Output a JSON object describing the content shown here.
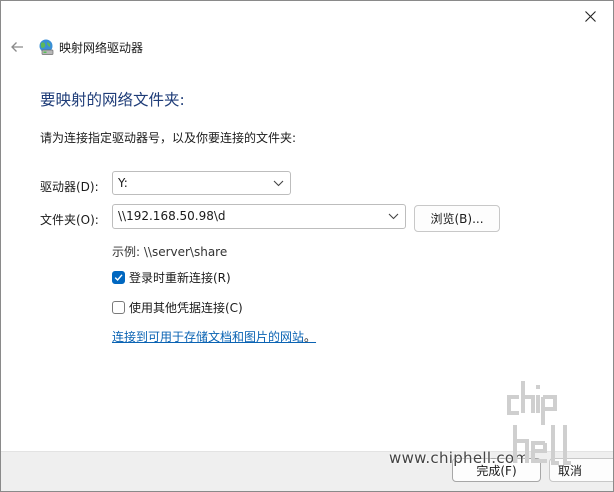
{
  "wizard": {
    "title": "映射网络驱动器",
    "heading": "要映射的网络文件夹:",
    "instruction": "请为连接指定驱动器号，以及你要连接的文件夹:"
  },
  "form": {
    "drive_label": "驱动器(D):",
    "drive_value": "Y:",
    "folder_label": "文件夹(O):",
    "folder_value": "\\\\192.168.50.98\\d",
    "browse_label": "浏览(B)...",
    "example_text": "示例: \\\\server\\share",
    "reconnect_label": "登录时重新连接(R)",
    "reconnect_checked": true,
    "credentials_label": "使用其他凭据连接(C)",
    "credentials_checked": false,
    "link_text": "连接到可用于存储文档和图片的网站",
    "link_suffix": "。"
  },
  "footer": {
    "finish_label": "完成(F)",
    "cancel_label": "取消"
  },
  "watermark": {
    "url": "www.chiphell.com",
    "logo_text": "chip hell"
  },
  "colors": {
    "heading": "#1e3c78",
    "link": "#0a63b3",
    "checkbox_accent": "#0067c0"
  },
  "icons": {
    "close": "close-icon",
    "back": "back-arrow-icon",
    "wizard": "network-drive-icon",
    "dropdown": "chevron-down-icon",
    "check": "checkmark-icon"
  }
}
